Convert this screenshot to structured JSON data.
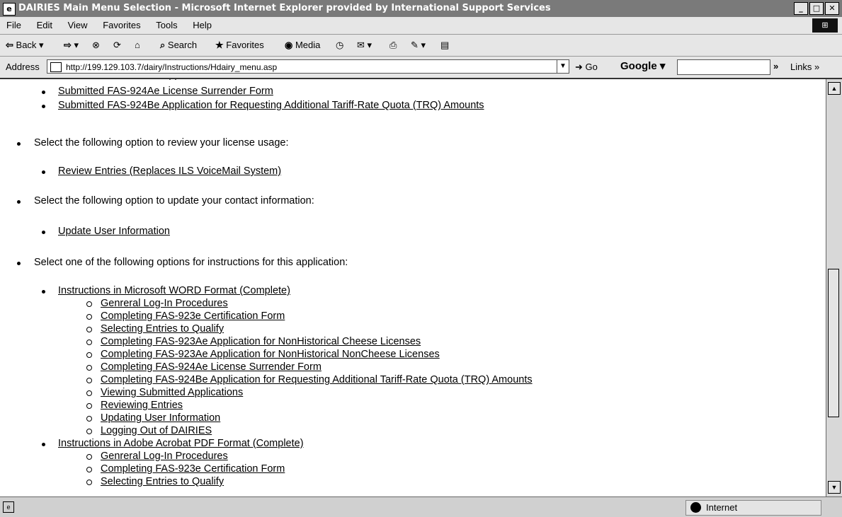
{
  "window": {
    "title": "DAIRIES Main Menu Selection - Microsoft Internet Explorer provided by International Support Services"
  },
  "menu": [
    "File",
    "Edit",
    "View",
    "Favorites",
    "Tools",
    "Help"
  ],
  "toolbar": {
    "back": "Back",
    "search": "Search",
    "favorites": "Favorites",
    "media": "Media"
  },
  "address": {
    "label": "Address",
    "url": "http://199.129.103.7/dairy/Instructions/Hdairy_menu.asp",
    "go": "Go",
    "google": "Google",
    "links": "Links"
  },
  "content": {
    "top_links": [
      "Submitted FAS-924Ae License Surrender Form",
      "Submitted FAS-924Be Application for Requesting Additional Tariff-Rate Quota (TRQ) Amounts"
    ],
    "sections": [
      {
        "prompt": "Select the following option to review your license usage:",
        "links": [
          "Review Entries (Replaces ILS VoiceMail System)"
        ]
      },
      {
        "prompt": "Select the following option to update your contact information:",
        "links": [
          "Update User Information"
        ]
      },
      {
        "prompt": "Select one of the following options for instructions for this application:"
      }
    ],
    "instructions": [
      {
        "label": "Instructions in Microsoft WORD Format (Complete)",
        "items": [
          "Genreral Log-In Procedures",
          "Completing FAS-923e Certification Form",
          "Selecting Entries to Qualify",
          "Completing FAS-923Ae Application for NonHistorical Cheese Licenses",
          "Completing FAS-923Ae Application for NonHistorical NonCheese Licenses",
          "Completing FAS-924Ae License Surrender Form",
          "Completing FAS-924Be Application for Requesting Additional Tariff-Rate Quota (TRQ) Amounts",
          "Viewing Submitted Applications",
          "Reviewing Entries",
          "Updating User Information",
          "Logging Out of DAIRIES"
        ]
      },
      {
        "label": "Instructions in Adobe Acrobat PDF Format (Complete)",
        "items": [
          "Genreral Log-In Procedures",
          "Completing FAS-923e Certification Form",
          "Selecting Entries to Qualify"
        ]
      }
    ]
  },
  "status": {
    "zone": "Internet"
  }
}
